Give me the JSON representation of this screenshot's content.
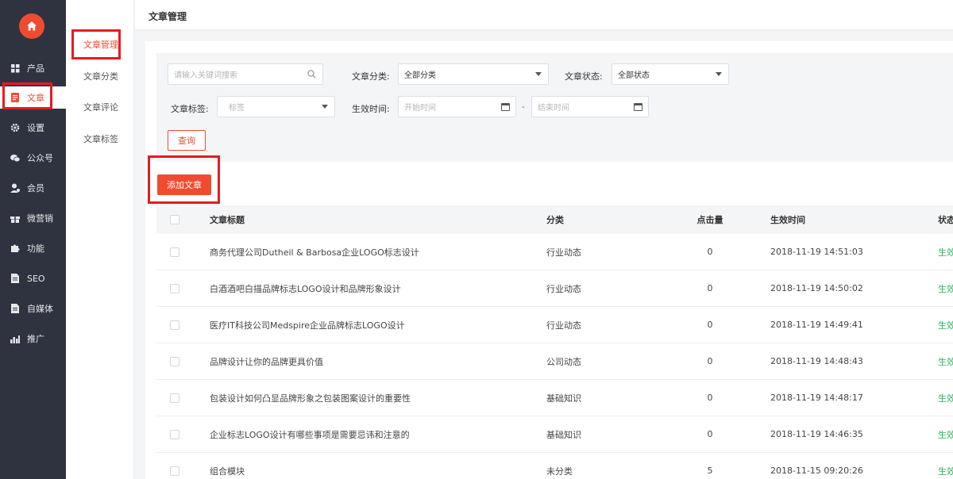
{
  "rail": {
    "items": [
      {
        "label": "产品",
        "icon": "grid-icon"
      },
      {
        "label": "文章",
        "icon": "document-icon"
      },
      {
        "label": "设置",
        "icon": "gear-icon"
      },
      {
        "label": "公众号",
        "icon": "wechat-icon"
      },
      {
        "label": "会员",
        "icon": "member-icon"
      },
      {
        "label": "微营销",
        "icon": "gift-icon"
      },
      {
        "label": "功能",
        "icon": "puzzle-icon"
      },
      {
        "label": "SEO",
        "icon": "file-icon"
      },
      {
        "label": "自媒体",
        "icon": "file-icon"
      },
      {
        "label": "推广",
        "icon": "bar-chart-icon"
      }
    ],
    "active_index": 1
  },
  "subnav": {
    "items": [
      "文章管理",
      "文章分类",
      "文章评论",
      "文章标签"
    ],
    "active_index": 0
  },
  "header": {
    "title": "文章管理"
  },
  "filters": {
    "search_placeholder": "请输入关键词搜索",
    "category_label": "文章分类:",
    "category_value": "全部分类",
    "status_label": "文章状态:",
    "status_value": "全部状态",
    "tag_label": "文章标签:",
    "tag_placeholder": "标签",
    "time_label": "生效时间:",
    "start_placeholder": "开始时间",
    "range_sep": "-",
    "end_placeholder": "结束时间",
    "query_button": "查询"
  },
  "add_button": "添加文章",
  "table": {
    "headers": {
      "title": "文章标题",
      "category": "分类",
      "clicks": "点击量",
      "time": "生效时间",
      "status": "状态"
    },
    "rows": [
      {
        "title": "商务代理公司Dutheil & Barbosa企业LOGO标志设计",
        "category": "行业动态",
        "clicks": "0",
        "time": "2018-11-19 14:51:03",
        "status": "生效"
      },
      {
        "title": "白酒酒吧白描品牌标志LOGO设计和品牌形象设计",
        "category": "行业动态",
        "clicks": "0",
        "time": "2018-11-19 14:50:02",
        "status": "生效"
      },
      {
        "title": "医疗IT科技公司Medspire企业品牌标志LOGO设计",
        "category": "行业动态",
        "clicks": "0",
        "time": "2018-11-19 14:49:41",
        "status": "生效"
      },
      {
        "title": "品牌设计让你的品牌更具价值",
        "category": "公司动态",
        "clicks": "0",
        "time": "2018-11-19 14:48:43",
        "status": "生效"
      },
      {
        "title": "包装设计如何凸显品牌形象之包装图案设计的重要性",
        "category": "基础知识",
        "clicks": "0",
        "time": "2018-11-19 14:48:17",
        "status": "生效"
      },
      {
        "title": "企业标志LOGO设计有哪些事项是需要忌讳和注意的",
        "category": "基础知识",
        "clicks": "0",
        "time": "2018-11-19 14:46:35",
        "status": "生效"
      },
      {
        "title": "组合模块",
        "category": "未分类",
        "clicks": "5",
        "time": "2018-11-15 09:20:26",
        "status": "生效"
      }
    ]
  },
  "colors": {
    "accent": "#f04b30",
    "rail_bg": "#2f3340",
    "status_green": "#2ab15c",
    "highlight": "#e51b23"
  }
}
